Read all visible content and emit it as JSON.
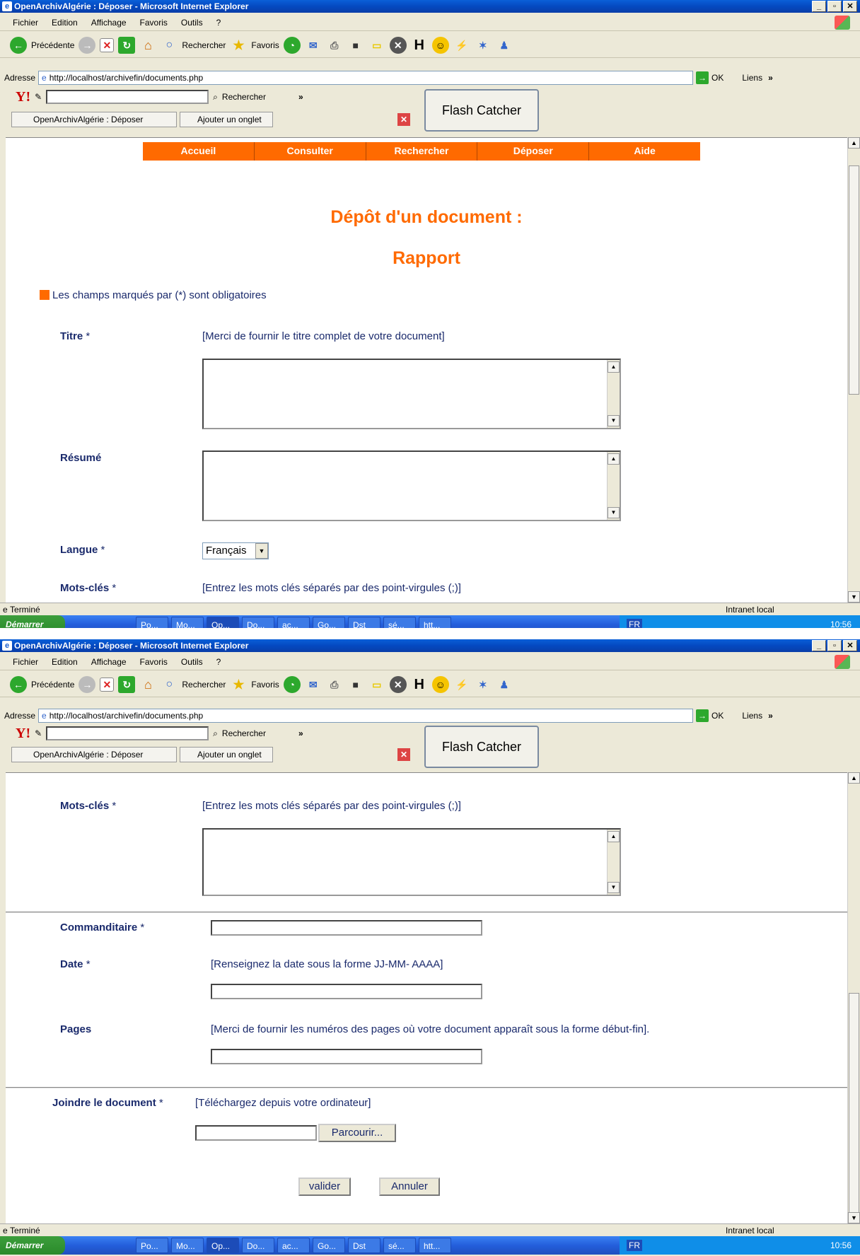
{
  "browser": {
    "title": "OpenArchivAlgérie : Déposer - Microsoft Internet Explorer",
    "menu": [
      "Fichier",
      "Edition",
      "Affichage",
      "Favoris",
      "Outils",
      "?"
    ],
    "toolbar": {
      "back": "Précédente",
      "search": "Rechercher",
      "favorites": "Favoris"
    },
    "address_label": "Adresse",
    "url": "http://localhost/archivefin/documents.php",
    "go": "OK",
    "links": "Liens",
    "yahoo_search": "Rechercher",
    "tab_title": "OpenArchivAlgérie : Déposer",
    "add_tab": "Ajouter un onglet",
    "flash_catcher": "Flash Catcher",
    "status": "Terminé",
    "zone": "Intranet local"
  },
  "taskbar": {
    "start": "Démarrer",
    "items": [
      "Po...",
      "Mo...",
      "Op...",
      "Do...",
      "ac...",
      "Go...",
      "Dst",
      "sé...",
      "htt..."
    ],
    "lang": "FR",
    "clock": "10:56"
  },
  "nav": [
    "Accueil",
    "Consulter",
    "Rechercher",
    "Déposer",
    "Aide"
  ],
  "page": {
    "heading": "Dépôt d'un document :",
    "subheading": "Rapport",
    "required_note": "Les champs marqués par (*) sont obligatoires",
    "star": "*"
  },
  "form": {
    "titre_label": "Titre",
    "titre_hint": "[Merci de fournir le titre complet de votre document]",
    "resume_label": "Résumé",
    "langue_label": "Langue",
    "langue_value": "Français",
    "motscles_label": "Mots-clés",
    "motscles_hint": "[Entrez les mots clés séparés par des point-virgules (;)]",
    "commanditaire_label": "Commanditaire",
    "date_label": "Date",
    "date_hint": "[Renseignez la date sous la forme JJ-MM- AAAA]",
    "pages_label": "Pages",
    "pages_hint": "[Merci de fournir les numéros des pages où votre document apparaît sous la forme début-fin].",
    "joindre_label": "Joindre le document",
    "joindre_hint": "[Téléchargez depuis votre ordinateur]",
    "browse": "Parcourir...",
    "submit": "valider",
    "cancel": "Annuler"
  },
  "colors": {
    "accent": "#ff6a00",
    "label": "#1a2a6c"
  }
}
